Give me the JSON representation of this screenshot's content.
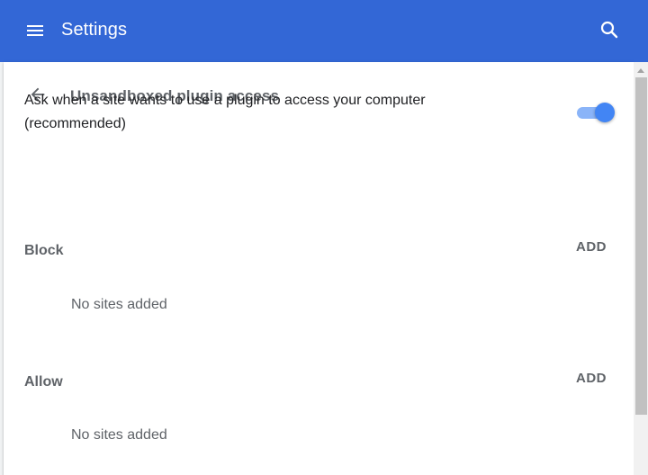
{
  "header": {
    "title": "Settings",
    "menu_icon": "menu-icon",
    "search_icon": "search-icon",
    "bar_color": "#3367d6"
  },
  "page": {
    "back_icon": "arrow-back-icon",
    "title": "Unsandboxed plugin access"
  },
  "setting": {
    "label": "Ask when a site wants to use a plugin to access your computer (recommended)",
    "toggle_on": true,
    "toggle_color": "#4285f4"
  },
  "sections": {
    "block": {
      "heading": "Block",
      "add_label": "ADD",
      "empty_text": "No sites added"
    },
    "allow": {
      "heading": "Allow",
      "add_label": "ADD",
      "empty_text": "No sites added"
    }
  }
}
